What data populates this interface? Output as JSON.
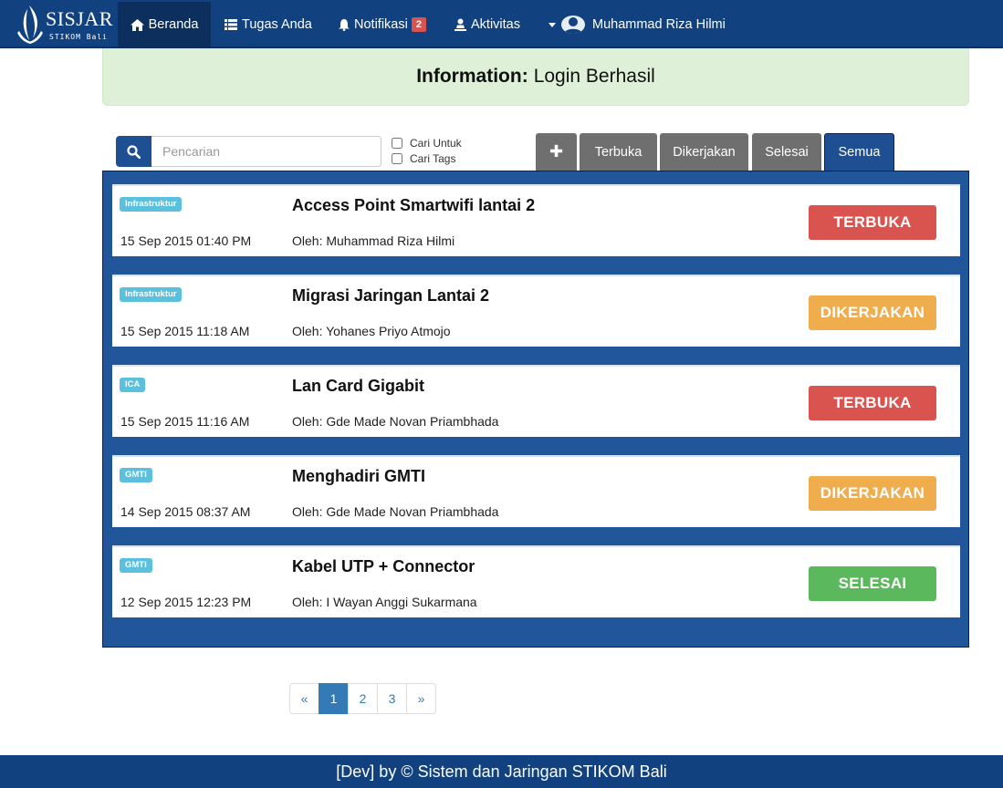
{
  "brand": {
    "name": "SISJAR",
    "sub": "STIKOM Bali"
  },
  "nav": {
    "home": "Beranda",
    "tasks": "Tugas Anda",
    "notifications": "Notifikasi",
    "notification_count": "2",
    "activity": "Aktivitas",
    "user": "Muhammad Riza Hilmi"
  },
  "alert": {
    "label": "Information:",
    "message": "Login Berhasil"
  },
  "search": {
    "placeholder": "Pencarian",
    "value": "",
    "option_for": "Cari Untuk",
    "option_tags": "Cari Tags"
  },
  "tabs": {
    "add": "✚",
    "open": "Terbuka",
    "in_progress": "Dikerjakan",
    "done": "Selesai",
    "all": "Semua"
  },
  "tasks": [
    {
      "tag": "Infrastruktur",
      "title": "Access Point Smartwifi lantai 2",
      "date": "15 Sep 2015 01:40 PM",
      "by": "Oleh: Muhammad Riza Hilmi",
      "status": "TERBUKA",
      "status_color": "#d9534f"
    },
    {
      "tag": "Infrastruktur",
      "title": "Migrasi Jaringan Lantai 2",
      "date": "15 Sep 2015 11:18 AM",
      "by": "Oleh: Yohanes Priyo Atmojo",
      "status": "DIKERJAKAN",
      "status_color": "#f0ad4e"
    },
    {
      "tag": "ICA",
      "title": "Lan Card Gigabit",
      "date": "15 Sep 2015 11:16 AM",
      "by": "Oleh: Gde Made Novan Priambhada",
      "status": "TERBUKA",
      "status_color": "#d9534f"
    },
    {
      "tag": "GMTI",
      "title": "Menghadiri GMTI",
      "date": "14 Sep 2015 08:37 AM",
      "by": "Oleh: Gde Made Novan Priambhada",
      "status": "DIKERJAKAN",
      "status_color": "#f0ad4e"
    },
    {
      "tag": "GMTI",
      "title": "Kabel UTP + Connector",
      "date": "12 Sep 2015 12:23 PM",
      "by": "Oleh: I Wayan Anggi Sukarmana",
      "status": "SELESAI",
      "status_color": "#5cb85c"
    }
  ],
  "pagination": {
    "prev": "«",
    "pages": [
      "1",
      "2",
      "3"
    ],
    "current": "1",
    "next": "»"
  },
  "footer": {
    "text": "[Dev] by © Sistem dan Jaringan STIKOM Bali"
  },
  "colors": {
    "navbar": "#11427f",
    "panel": "#22569a",
    "alert_bg": "#dff0d8",
    "tab_inactive": "#6f6f6f",
    "tab_active": "#1f4f93"
  }
}
